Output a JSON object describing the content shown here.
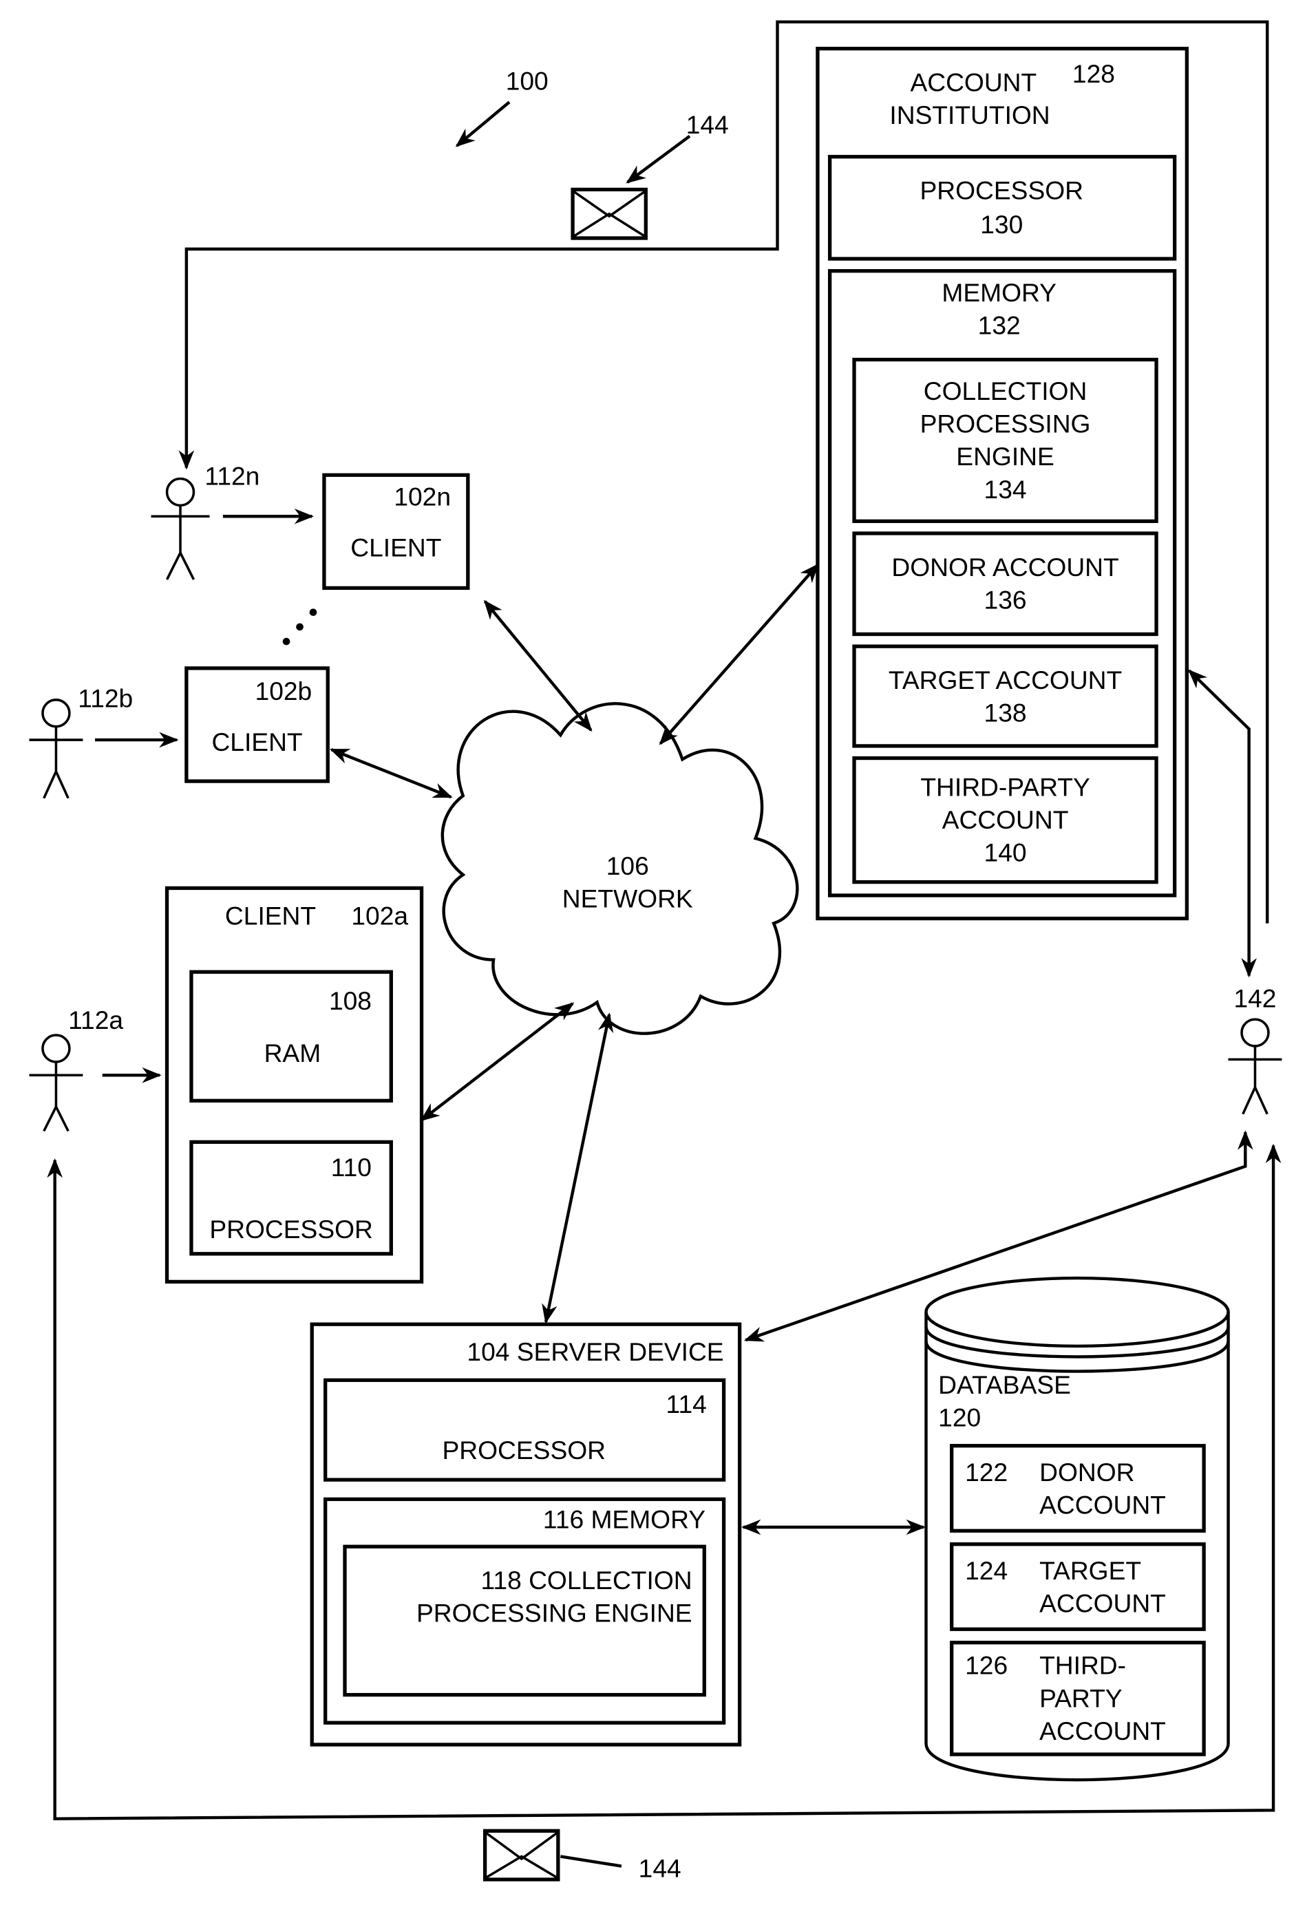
{
  "figure": {
    "ref": "100",
    "message_ref": "144"
  },
  "institution": {
    "title_line1": "ACCOUNT",
    "title_line2": "INSTITUTION",
    "ref": "128",
    "processor": {
      "label": "PROCESSOR",
      "ref": "130"
    },
    "memory": {
      "label": "MEMORY",
      "ref": "132"
    },
    "engine": {
      "line1": "COLLECTION",
      "line2": "PROCESSING",
      "line3": "ENGINE",
      "ref": "134"
    },
    "donor": {
      "label": "DONOR ACCOUNT",
      "ref": "136"
    },
    "target": {
      "label": "TARGET ACCOUNT",
      "ref": "138"
    },
    "third_party": {
      "line1": "THIRD-PARTY",
      "line2": "ACCOUNT",
      "ref": "140"
    }
  },
  "users": {
    "n": "112n",
    "b": "112b",
    "a": "112a",
    "recipient": "142"
  },
  "clients": {
    "n": {
      "label": "CLIENT",
      "ref": "102n"
    },
    "b": {
      "label": "CLIENT",
      "ref": "102b"
    },
    "a": {
      "label": "CLIENT",
      "ref": "102a",
      "ram": {
        "label": "RAM",
        "ref": "108"
      },
      "processor": {
        "label": "PROCESSOR",
        "ref": "110"
      }
    }
  },
  "network": {
    "ref": "106",
    "label": "NETWORK"
  },
  "server": {
    "title": "104 SERVER DEVICE",
    "processor": {
      "label": "PROCESSOR",
      "ref": "114"
    },
    "memory": {
      "title": "116 MEMORY"
    },
    "engine": {
      "line1": "118 COLLECTION",
      "line2": "PROCESSING ENGINE"
    }
  },
  "database": {
    "label": "DATABASE",
    "ref": "120",
    "donor": {
      "ref": "122",
      "line1": "DONOR",
      "line2": "ACCOUNT"
    },
    "target": {
      "ref": "124",
      "line1": "TARGET",
      "line2": "ACCOUNT"
    },
    "third_party": {
      "ref": "126",
      "line1": "THIRD-",
      "line2": "PARTY",
      "line3": "ACCOUNT"
    }
  }
}
